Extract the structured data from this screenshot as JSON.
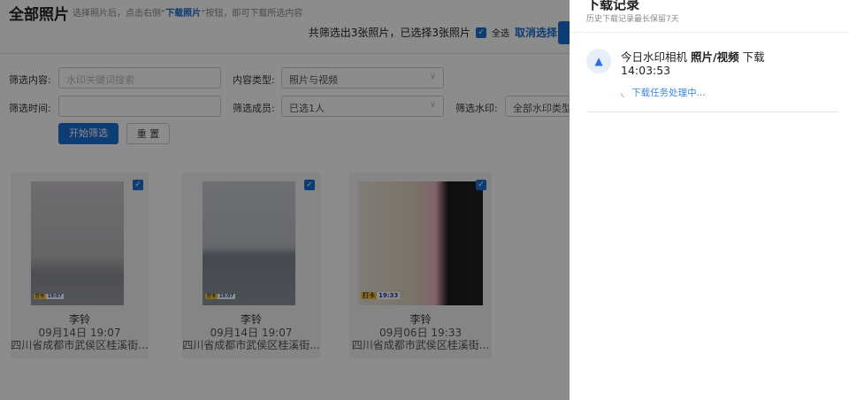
{
  "page": {
    "title": "全部照片",
    "hint_pre": "选择照片后，点击右侧“",
    "hint_link": "下载照片",
    "hint_post": "”按钮，即可下载所选内容",
    "selection_summary": "共筛选出3张照片，已选择3张照片",
    "select_all": "全选",
    "cancel_select": "取消选择"
  },
  "filters": {
    "content_label": "筛选内容:",
    "content_placeholder": "水印关键词搜索",
    "type_label": "内容类型:",
    "type_value": "照片与视频",
    "time_label": "筛选时间:",
    "time_value": "",
    "member_label": "筛选成员:",
    "member_value": "已选1人",
    "watermark_label": "筛选水印:",
    "watermark_value": "全部水印类型",
    "start_button": "开始筛选",
    "reset_button": "重 置"
  },
  "photos": [
    {
      "name": "李铃",
      "date": "09月14日 19:07",
      "address": "四川省成都市武侯区桂溪街...",
      "wm_tag": "打卡",
      "wm_time": "19:07"
    },
    {
      "name": "李铃",
      "date": "09月14日 19:07",
      "address": "四川省成都市武侯区桂溪街...",
      "wm_tag": "打卡",
      "wm_time": "19:07"
    },
    {
      "name": "李铃",
      "date": "09月06日 19:33",
      "address": "四川省成都市武侯区桂溪街...",
      "wm_tag": "打卡",
      "wm_time": "19:33"
    }
  ],
  "drawer": {
    "title": "下载记录",
    "subtitle": "历史下载记录最长保留7天",
    "record": {
      "app": "今日水印相机",
      "type": "照片/视频",
      "action": "下载",
      "time": "14:03:53",
      "status": "下载任务处理中..."
    }
  },
  "colors": {
    "accent": "#1a6fd1"
  }
}
